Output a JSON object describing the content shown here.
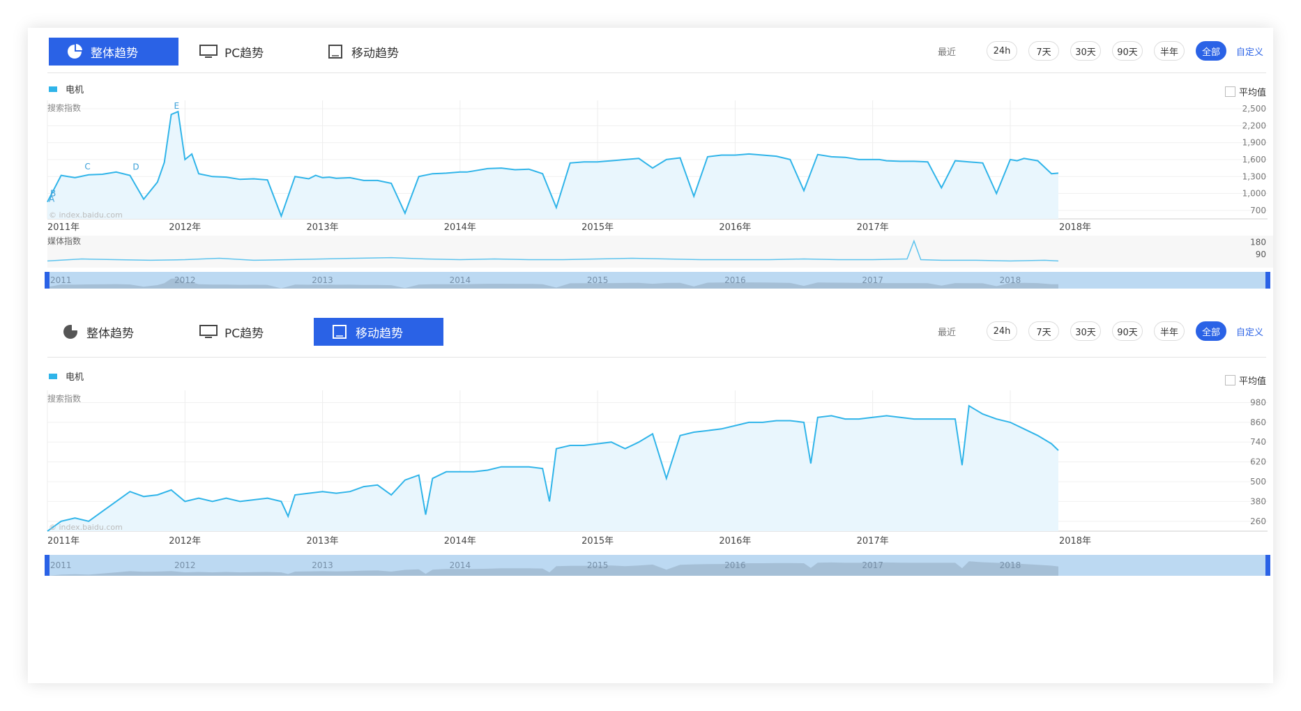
{
  "tabs": {
    "overall": "整体趋势",
    "pc": "PC趋势",
    "mobile": "移动趋势"
  },
  "ranges": {
    "label": "最近",
    "buttons": [
      "24h",
      "7天",
      "30天",
      "90天",
      "半年",
      "全部"
    ],
    "selected": "全部",
    "custom": "自定义"
  },
  "legend": {
    "series": "电机",
    "avg_label": "平均值"
  },
  "watermark": "© index.baidu.com",
  "colors": {
    "accent": "#2a62e6",
    "series": "#2fb4e9"
  },
  "chart_data": [
    {
      "type": "area",
      "title": "整体趋势",
      "ylabel": "搜索指数",
      "xlabels": [
        "2011年",
        "2012年",
        "2013年",
        "2014年",
        "2015年",
        "2016年",
        "2017年",
        "2018年"
      ],
      "yticks": [
        700,
        1000,
        1300,
        1600,
        1900,
        2200,
        2500
      ],
      "ylim": [
        550,
        2550
      ],
      "annotations": [
        "A",
        "B",
        "C",
        "D",
        "E"
      ],
      "series": [
        {
          "name": "电机",
          "x": [
            2011.0,
            2011.1,
            2011.2,
            2011.3,
            2011.4,
            2011.5,
            2011.6,
            2011.7,
            2011.8,
            2011.85,
            2011.9,
            2011.95,
            2012.0,
            2012.05,
            2012.1,
            2012.2,
            2012.3,
            2012.4,
            2012.5,
            2012.6,
            2012.7,
            2012.8,
            2012.9,
            2012.95,
            2013.0,
            2013.05,
            2013.1,
            2013.2,
            2013.3,
            2013.4,
            2013.5,
            2013.6,
            2013.7,
            2013.8,
            2013.9,
            2014.0,
            2014.05,
            2014.1,
            2014.2,
            2014.3,
            2014.4,
            2014.5,
            2014.6,
            2014.7,
            2014.8,
            2014.9,
            2015.0,
            2015.05,
            2015.1,
            2015.2,
            2015.3,
            2015.4,
            2015.5,
            2015.6,
            2015.7,
            2015.8,
            2015.9,
            2016.0,
            2016.05,
            2016.1,
            2016.2,
            2016.3,
            2016.4,
            2016.5,
            2016.6,
            2016.7,
            2016.8,
            2016.9,
            2017.0,
            2017.05,
            2017.1,
            2017.2,
            2017.3,
            2017.4,
            2017.5,
            2017.6,
            2017.7,
            2017.8,
            2017.9,
            2018.0,
            2018.05,
            2018.1,
            2018.2,
            2018.3,
            2018.35
          ],
          "values": [
            850,
            1320,
            1280,
            1330,
            1340,
            1380,
            1320,
            900,
            1200,
            1550,
            2400,
            2450,
            1600,
            1700,
            1350,
            1300,
            1290,
            1250,
            1260,
            1240,
            600,
            1300,
            1260,
            1320,
            1280,
            1290,
            1270,
            1280,
            1230,
            1230,
            1180,
            650,
            1300,
            1350,
            1360,
            1380,
            1380,
            1400,
            1440,
            1450,
            1420,
            1430,
            1350,
            750,
            1540,
            1560,
            1560,
            1570,
            1580,
            1600,
            1620,
            1450,
            1600,
            1630,
            950,
            1650,
            1680,
            1680,
            1690,
            1700,
            1680,
            1660,
            1600,
            1050,
            1690,
            1650,
            1640,
            1600,
            1600,
            1600,
            1580,
            1570,
            1570,
            1560,
            1100,
            1580,
            1560,
            1540,
            1000,
            1600,
            1580,
            1620,
            1580,
            1350,
            1360
          ]
        }
      ]
    },
    {
      "type": "line",
      "title": "媒体指数",
      "ylabel": "媒体指数",
      "yticks": [
        90,
        180
      ],
      "ylim": [
        0,
        220
      ],
      "series": [
        {
          "name": "电机",
          "x": [
            2011.0,
            2011.25,
            2011.5,
            2011.75,
            2012.0,
            2012.25,
            2012.5,
            2012.75,
            2013.0,
            2013.25,
            2013.5,
            2013.75,
            2014.0,
            2014.25,
            2014.5,
            2014.75,
            2015.0,
            2015.25,
            2015.5,
            2015.75,
            2016.0,
            2016.25,
            2016.5,
            2016.75,
            2017.0,
            2017.25,
            2017.3,
            2017.35,
            2017.5,
            2017.75,
            2018.0,
            2018.25,
            2018.35
          ],
          "values": [
            40,
            55,
            50,
            45,
            50,
            60,
            45,
            50,
            55,
            60,
            65,
            55,
            50,
            55,
            50,
            50,
            55,
            60,
            55,
            50,
            50,
            50,
            55,
            50,
            50,
            55,
            190,
            50,
            45,
            45,
            40,
            45,
            40
          ]
        }
      ]
    },
    {
      "type": "area",
      "title": "移动趋势",
      "ylabel": "搜索指数",
      "xlabels": [
        "2011年",
        "2012年",
        "2013年",
        "2014年",
        "2015年",
        "2016年",
        "2017年",
        "2018年"
      ],
      "yticks": [
        260,
        380,
        500,
        620,
        740,
        860,
        980
      ],
      "ylim": [
        200,
        1020
      ],
      "series": [
        {
          "name": "电机",
          "x": [
            2011.0,
            2011.1,
            2011.2,
            2011.3,
            2011.4,
            2011.5,
            2011.6,
            2011.7,
            2011.8,
            2011.9,
            2012.0,
            2012.1,
            2012.2,
            2012.3,
            2012.4,
            2012.5,
            2012.6,
            2012.7,
            2012.75,
            2012.8,
            2012.9,
            2013.0,
            2013.1,
            2013.2,
            2013.3,
            2013.4,
            2013.5,
            2013.6,
            2013.7,
            2013.75,
            2013.8,
            2013.9,
            2014.0,
            2014.1,
            2014.2,
            2014.3,
            2014.4,
            2014.5,
            2014.6,
            2014.65,
            2014.7,
            2014.8,
            2014.9,
            2015.0,
            2015.1,
            2015.2,
            2015.3,
            2015.4,
            2015.5,
            2015.6,
            2015.7,
            2015.8,
            2015.9,
            2016.0,
            2016.1,
            2016.2,
            2016.3,
            2016.4,
            2016.5,
            2016.55,
            2016.6,
            2016.7,
            2016.8,
            2016.9,
            2017.0,
            2017.1,
            2017.2,
            2017.3,
            2017.4,
            2017.5,
            2017.6,
            2017.65,
            2017.7,
            2017.8,
            2017.9,
            2018.0,
            2018.1,
            2018.2,
            2018.3,
            2018.35
          ],
          "values": [
            200,
            260,
            280,
            260,
            320,
            380,
            440,
            410,
            420,
            450,
            380,
            400,
            380,
            400,
            380,
            390,
            400,
            380,
            290,
            420,
            430,
            440,
            430,
            440,
            470,
            480,
            420,
            510,
            540,
            300,
            520,
            560,
            560,
            560,
            570,
            590,
            590,
            590,
            580,
            380,
            700,
            720,
            720,
            730,
            740,
            700,
            740,
            790,
            520,
            780,
            800,
            810,
            820,
            840,
            860,
            860,
            870,
            870,
            860,
            610,
            890,
            900,
            880,
            880,
            890,
            900,
            890,
            880,
            880,
            880,
            880,
            600,
            960,
            910,
            880,
            860,
            820,
            780,
            730,
            690
          ]
        }
      ]
    }
  ]
}
